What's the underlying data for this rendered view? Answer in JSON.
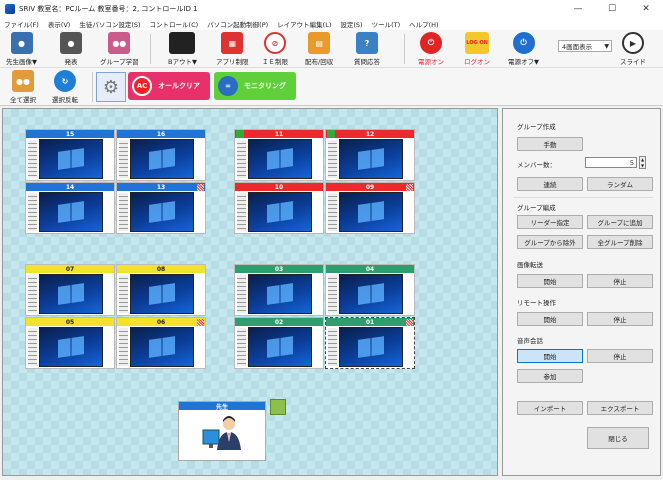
{
  "window": {
    "title": "SRIV  教室名：PCルーム  教室番号：2,  コントロールID 1",
    "min": "—",
    "max": "☐",
    "close": "✕"
  },
  "menu": [
    "ファイル(F)",
    "表示(V)",
    "生徒パソコン設定(S)",
    "コントロール(C)",
    "パソコン起動制御(P)",
    "レイアウト編集(L)",
    "設定(S)",
    "ツール(T)",
    "ヘルプ(H)"
  ],
  "toolbar": {
    "teacher_screen": "先生画像▼",
    "present": "発表",
    "group_learning": "グループ学習",
    "b_out": "Bアウト▼",
    "app_control": "アプリ制限",
    "ie_control": "ＩＥ制限",
    "distribute": "配布/回収",
    "issue_answer": "質問応答",
    "power_on": "電源オン",
    "logon": "ログオン",
    "logon_badge": "LOG ON",
    "power_off": "電源オフ▼",
    "display_select": "4画面表示",
    "slide": "スライド",
    "select_all": "全て選択",
    "invert_select": "選択反転",
    "all_clear": "オールクリア",
    "all_clear_icon": "AC",
    "monitoring": "モニタリング"
  },
  "pcs": [
    {
      "label": "15",
      "color": "#1f74d6"
    },
    {
      "label": "16",
      "color": "#1f74d6"
    },
    {
      "label": "14",
      "color": "#1f74d6"
    },
    {
      "label": "13",
      "color": "#1f74d6"
    },
    {
      "label": "11",
      "color": "#ec2a2a"
    },
    {
      "label": "12",
      "color": "#ec2a2a"
    },
    {
      "label": "10",
      "color": "#ec2a2a"
    },
    {
      "label": "09",
      "color": "#ec2a2a"
    },
    {
      "label": "07",
      "color": "#f1e22a"
    },
    {
      "label": "08",
      "color": "#f1e22a"
    },
    {
      "label": "05",
      "color": "#f1e22a"
    },
    {
      "label": "06",
      "color": "#f1e22a"
    },
    {
      "label": "03",
      "color": "#2f9e6e"
    },
    {
      "label": "04",
      "color": "#2f9e6e"
    },
    {
      "label": "02",
      "color": "#2f9e6e"
    },
    {
      "label": "01",
      "color": "#2f9e6e"
    }
  ],
  "teacher_label": "先生",
  "panel": {
    "group_create": "グループ作成",
    "manual": "手動",
    "member_count": "メンバー数：",
    "member_value": "5",
    "continuous": "連続",
    "random": "ランダム",
    "group_edit": "グループ編成",
    "leader": "リーダー指定",
    "add_group": "グループに追加",
    "remove_group": "グループから除外",
    "delete_all": "全グループ削除",
    "screen_transfer": "画像転送",
    "start1": "開始",
    "stop1": "停止",
    "remote": "リモート操作",
    "start2": "開始",
    "stop2": "停止",
    "voice": "音声会話",
    "start3": "開始",
    "stop3": "停止",
    "join": "参加",
    "import": "インポート",
    "export": "エクスポート",
    "close": "閉じる"
  }
}
